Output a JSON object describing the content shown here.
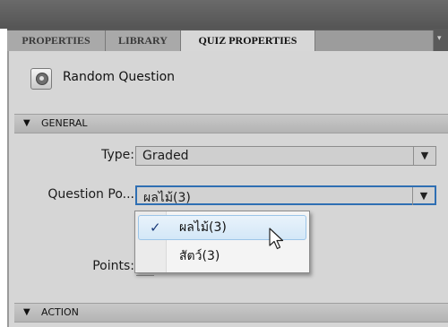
{
  "tabs": [
    {
      "label": "PROPERTIES",
      "active": false
    },
    {
      "label": "LIBRARY",
      "active": false
    },
    {
      "label": "QUIZ PROPERTIES",
      "active": true
    }
  ],
  "header": {
    "icon": "random-question-icon",
    "title": "Random Question"
  },
  "sections": {
    "general": "GENERAL",
    "action": "ACTION"
  },
  "fields": {
    "type_label": "Type:",
    "type_value": "Graded",
    "question_pool_label": "Question Po...",
    "question_pool_value": "ผลไม้(3)",
    "points_label": "Points:"
  },
  "dropdown": {
    "options": [
      {
        "label": "ผลไม้(3)",
        "selected": true
      },
      {
        "label": "สัตว์(3)",
        "selected": false
      }
    ],
    "check_glyph": "✓"
  },
  "glyphs": {
    "collapse": "▼",
    "select_arrow": "▼",
    "panel_menu": "▾"
  },
  "colors": {
    "focus_border": "#2f6fb3",
    "highlight": "#d3e7f7"
  }
}
